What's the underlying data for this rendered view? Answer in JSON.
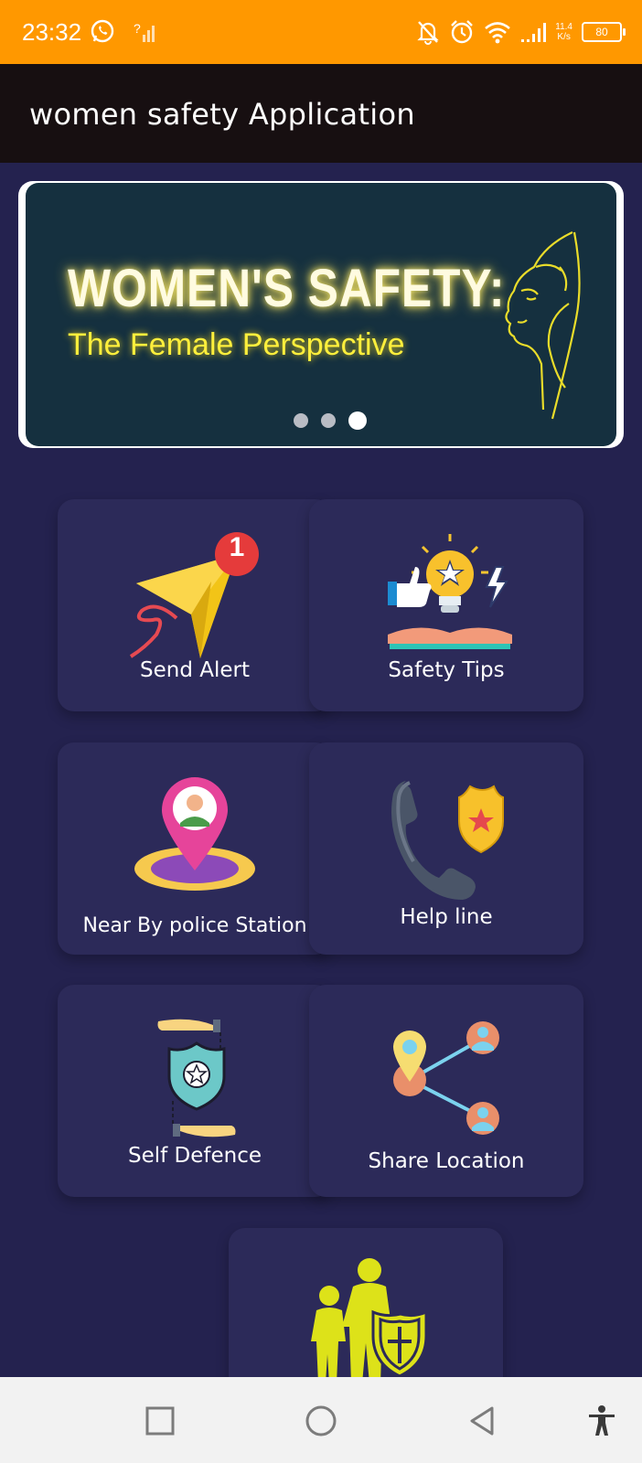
{
  "status_bar": {
    "time": "23:32",
    "net_speed_value": "11.4",
    "net_speed_unit": "K/s",
    "battery": "80"
  },
  "app_bar": {
    "title": "women safety Application"
  },
  "banner": {
    "headline": "WOMEN'S SAFETY:",
    "subheadline": "The Female Perspective",
    "slide_count": 3,
    "active_slide": 3
  },
  "cards": {
    "send_alert": {
      "label": "Send Alert",
      "badge": "1"
    },
    "safety_tips": {
      "label": "Safety Tips"
    },
    "police_station": {
      "label": "Near By police Station"
    },
    "help_line": {
      "label": "Help line"
    },
    "self_defence": {
      "label": "Self Defence"
    },
    "share_location": {
      "label": "Share Location"
    }
  },
  "colors": {
    "status_bar": "#ff9800",
    "app_bar": "#170f11",
    "background": "#24224f",
    "card": "#2c2a59",
    "banner": "#15303f"
  }
}
